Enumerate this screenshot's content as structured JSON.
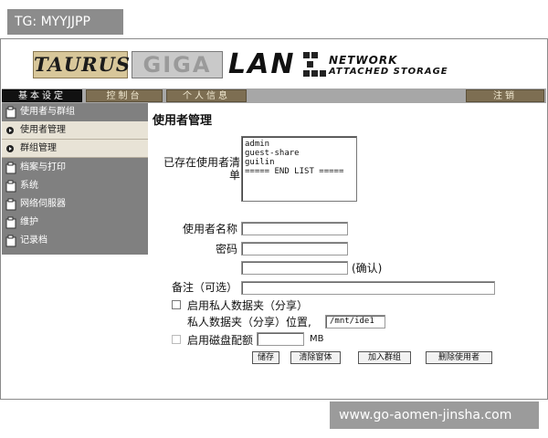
{
  "tag_label": "TG: MYYJJPP",
  "banner": {
    "brand1": "TAURUS",
    "brand2": "GIGA",
    "brand3": "LAN",
    "tagline1": "NETWORK",
    "tagline2": "ATTACHED STORAGE"
  },
  "nav": {
    "tabs": [
      "基本设定",
      "控制台",
      "个人信息"
    ],
    "logout": "注销"
  },
  "sidebar": {
    "items": [
      "使用者与群组",
      "使用者管理",
      "群组管理",
      "档案与打印",
      "系统",
      "网络伺服器",
      "维护",
      "记录档"
    ]
  },
  "main": {
    "title": "使用者管理",
    "existing_users_label": "已存在使用者清单",
    "user_list": [
      "admin",
      "guest-share",
      "guilin",
      "===== END LIST ====="
    ],
    "username_label": "使用者名称",
    "password_label": "密码",
    "confirm_label": "(确认)",
    "remark_label": "备注（可选）",
    "private_folder_label": "启用私人数据夹（分享）",
    "private_folder_location_label": "私人数据夹（分享）位置,",
    "private_folder_location_value": "/mnt/ide1",
    "quota_label": "启用磁盘配额",
    "quota_unit": "MB",
    "buttons": {
      "save": "储存",
      "clear": "清除窗体",
      "add_group": "加入群组",
      "delete_user": "删除使用者"
    }
  },
  "watermark": "www.go-aomen-jinsha.com"
}
